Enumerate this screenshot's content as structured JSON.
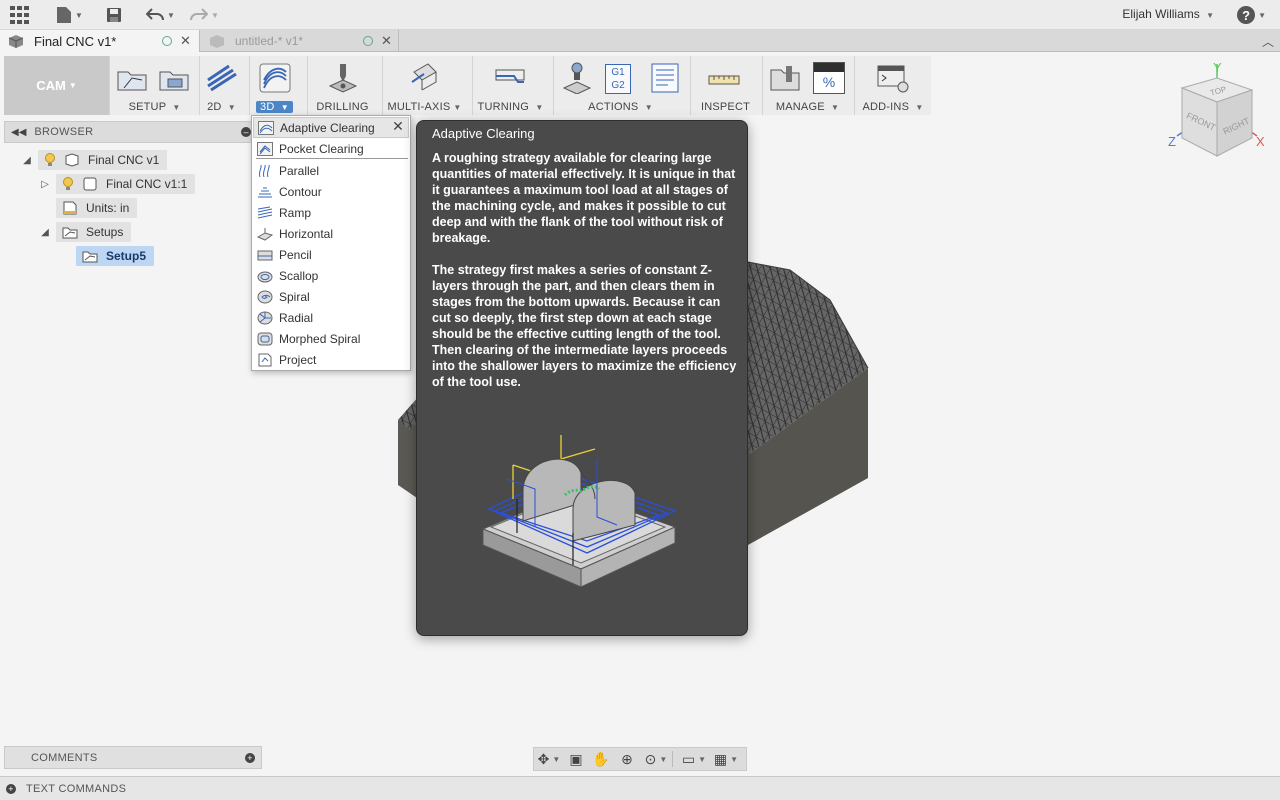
{
  "topbar": {
    "user_name": "Elijah Williams",
    "help_label": "?"
  },
  "tabs": [
    {
      "title": "Final CNC v1*",
      "active": true
    },
    {
      "title": "untitled-* v1*",
      "active": false
    }
  ],
  "toolbar": {
    "workspace": "CAM",
    "groups": [
      {
        "label": "SETUP"
      },
      {
        "label": "2D"
      },
      {
        "label": "3D",
        "selected": true
      },
      {
        "label": "DRILLING"
      },
      {
        "label": "MULTI-AXIS"
      },
      {
        "label": "TURNING"
      },
      {
        "label": "ACTIONS"
      },
      {
        "label": "INSPECT"
      },
      {
        "label": "MANAGE"
      },
      {
        "label": "ADD-INS"
      }
    ],
    "actions_g1": "G1",
    "actions_g2": "G2",
    "manage_pct": "%"
  },
  "browser": {
    "title": "BROWSER",
    "nodes": [
      {
        "label": "Final CNC v1"
      },
      {
        "label": "Final CNC v1:1"
      },
      {
        "label": "Units: in"
      },
      {
        "label": "Setups"
      },
      {
        "label": "Setup5",
        "selected": true
      }
    ]
  },
  "menu_3d": {
    "items": [
      {
        "label": "Adaptive Clearing",
        "highlighted": true
      },
      {
        "label": "Pocket Clearing"
      },
      {
        "label": "Parallel"
      },
      {
        "label": "Contour"
      },
      {
        "label": "Ramp"
      },
      {
        "label": "Horizontal"
      },
      {
        "label": "Pencil"
      },
      {
        "label": "Scallop"
      },
      {
        "label": "Spiral"
      },
      {
        "label": "Radial"
      },
      {
        "label": "Morphed Spiral"
      },
      {
        "label": "Project"
      }
    ]
  },
  "tooltip": {
    "title": "Adaptive Clearing",
    "paragraph1": "A roughing strategy available for clearing large quantities of material effectively. It is unique in that it guarantees a maximum tool load at all stages of the machining cycle, and makes it possible to cut deep and with the flank of the tool without risk of breakage.",
    "paragraph2": "The strategy first makes a series of constant Z-layers through the part, and then clears them in stages from the bottom upwards. Because it can cut so deeply, the first step down at each stage should be the effective cutting length of the tool. Then clearing of the intermediate layers proceeds into the shallower layers to maximize the efficiency of the tool use."
  },
  "viewcube": {
    "top": "TOP",
    "front": "FRONT",
    "right": "RIGHT",
    "axis_x": "X",
    "axis_y": "Y",
    "axis_z": "Z"
  },
  "comments": {
    "label": "COMMENTS"
  },
  "text_commands": {
    "label": "TEXT COMMANDS"
  },
  "colors": {
    "accent": "#4a86c8",
    "tooltip_bg": "#4a4a4a",
    "toolpath_blue": "#2a4fd8",
    "toolpath_yellow": "#e8d23a"
  }
}
